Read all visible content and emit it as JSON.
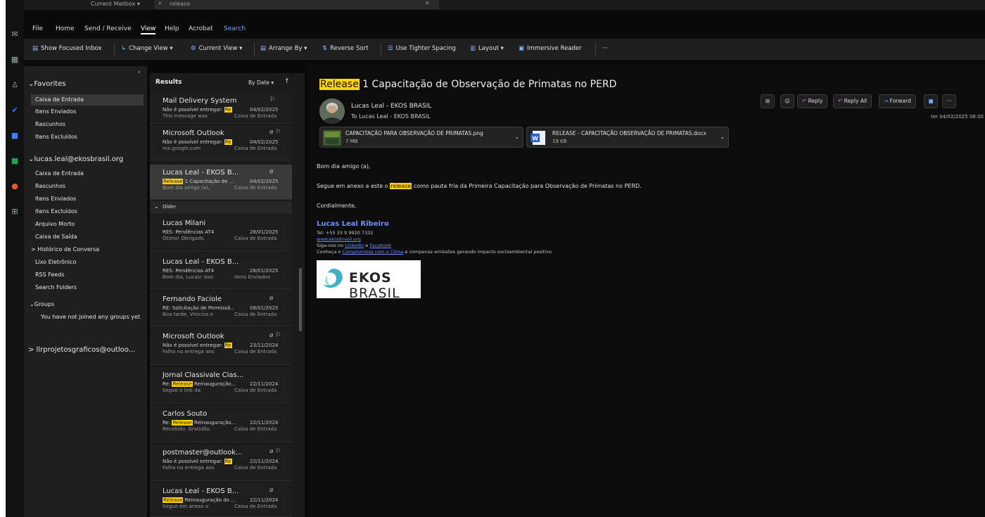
{
  "titlebar": {
    "mailbox_label": "Current Mailbox ▾",
    "search_text": "release"
  },
  "menu": {
    "file": "File",
    "home": "Home",
    "send_receive": "Send / Receive",
    "view": "View",
    "help": "Help",
    "acrobat": "Acrobat",
    "search": "Search"
  },
  "ribbon": {
    "focused_inbox": "Show Focused Inbox",
    "change_view": "Change View ▾",
    "current_view": "Current View ▾",
    "arrange_by": "Arrange By ▾",
    "reverse_sort": "Reverse Sort",
    "tighter_spacing": "Use Tighter Spacing",
    "layout": "Layout ▾",
    "immersive_reader": "Immersive Reader",
    "more": "···"
  },
  "folders": {
    "favorites_label": "Favorites",
    "favorites": [
      "Caixa de Entrada",
      "Itens Enviados",
      "Rascunhos",
      "Itens Excluídos"
    ],
    "account_label": "lucas.leal@ekosbrasil.org",
    "account_items": [
      "Caixa de Entrada",
      "Rascunhos",
      "Itens Enviados",
      "Itens Excluídos",
      "Arquivo Morto",
      "Caixa de Saída",
      "> Histórico de Conversa",
      "Lixo Eletrônico",
      "RSS Feeds",
      "Search Folders"
    ],
    "groups_label": "Groups",
    "groups_text": "You have not joined any groups yet",
    "other_account": "> llrprojetosgraficos@outloo..."
  },
  "list": {
    "title": "Results",
    "sort": "By Date ▾",
    "older_label": "Older",
    "items": [
      {
        "sender": "Mail Delivery System",
        "subject_pre": "Não é possível entregar: ",
        "subject_hl": "Re",
        "subject_post": "",
        "date": "04/02/2025",
        "preview": "This message was",
        "folder": "Caixa de Entrada",
        "icons": "⚐"
      },
      {
        "sender": "Microsoft Outlook",
        "subject_pre": "Não é possível entregar: ",
        "subject_hl": "Re",
        "subject_post": "",
        "date": "04/02/2025",
        "preview": "mx.google.com",
        "folder": "Caixa de Entrada",
        "icons": "⌀ ⚐"
      },
      {
        "sender": "Lucas Leal - EKOS B...",
        "subject_pre": "",
        "subject_hl": "Release",
        "subject_post": " 1 Capacitação de ...",
        "date": "04/02/2025",
        "preview": "Bom dia amigo (a),",
        "folder": "Caixa de Entrada",
        "icons": "⌀"
      },
      {
        "sender": "Lucas Milani",
        "subject_pre": "RES: Pendências AT4",
        "subject_hl": "",
        "subject_post": "",
        "date": "28/01/2025",
        "preview": "Ótimo! Obrigado,",
        "folder": "Caixa de Entrada",
        "icons": ""
      },
      {
        "sender": "Lucas Leal - EKOS B...",
        "subject_pre": "RES: Pendências AT4",
        "subject_hl": "",
        "subject_post": "",
        "date": "28/01/2025",
        "preview": "Bom dia, Lucas! Isso",
        "folder": "Itens Enviados",
        "icons": ""
      },
      {
        "sender": "Fernando Faciole",
        "subject_pre": "RE: Solicitação de Permissã...",
        "subject_hl": "",
        "subject_post": "",
        "date": "08/01/2025",
        "preview": "Boa tarde, Vinicius e",
        "folder": "Caixa de Entrada",
        "icons": "⌀"
      },
      {
        "sender": "Microsoft Outlook",
        "subject_pre": "Não é possível entregar: ",
        "subject_hl": "Re",
        "subject_post": "",
        "date": "23/11/2024",
        "preview": "Falha na entrega aos",
        "folder": "Caixa de Entrada",
        "icons": "⌀ ⚐"
      },
      {
        "sender": "Jornal Classivale Clas...",
        "subject_pre": "Re: ",
        "subject_hl": "Release",
        "subject_post": " Reinauguração...",
        "date": "22/11/2024",
        "preview": "Segue o link da",
        "folder": "Caixa de Entrada",
        "icons": ""
      },
      {
        "sender": "Carlos Souto",
        "subject_pre": "Re: ",
        "subject_hl": "Release",
        "subject_post": " Reinauguração...",
        "date": "22/11/2024",
        "preview": "Recebido. Gratidão.",
        "folder": "Caixa de Entrada",
        "icons": ""
      },
      {
        "sender": "postmaster@outlook...",
        "subject_pre": "Não é possível entregar: ",
        "subject_hl": "Re",
        "subject_post": "",
        "date": "22/11/2024",
        "preview": "Falha na entrega aos",
        "folder": "Caixa de Entrada",
        "icons": "⌀ ⚐"
      },
      {
        "sender": "Lucas Leal - EKOS B...",
        "subject_pre": "",
        "subject_hl": "Release",
        "subject_post": " Reinauguração do ...",
        "date": "22/11/2024",
        "preview": "Segue em anexo o",
        "folder": "Caixa de Entrada",
        "icons": "⌀"
      }
    ]
  },
  "reading": {
    "subject_hl": "Release",
    "subject_rest": " 1 Capacitação de Observação de Primatas no PERD",
    "from": "Lucas Leal - EKOS BRASIL",
    "to": "To  Lucas Leal - EKOS BRASIL",
    "timestamp": "ter 04/02/2025 08:00",
    "buttons": {
      "reply": "Reply",
      "reply_all": "Reply All",
      "forward": "Forward",
      "more": "···"
    },
    "attachments": [
      {
        "name": "CAPACITAÇÃO PARA OBSERVAÇÃO DE PRIMATAS.png",
        "size": "7 MB"
      },
      {
        "name": "RELEASE - CAPACITAÇÃO OBSERVAÇÃO DE PRIMATAS.docx",
        "size": "19 KB"
      }
    ],
    "greeting": "Bom dia amigo (a),",
    "body_pre": "Segue em anexo a este o ",
    "body_hl": "release",
    "body_post": " como pauta fria da Primeira Capacitação para Observação de Primatas no PERD.",
    "closing": "Cordialmente,",
    "signature": {
      "name": "Lucas Leal Ribeiro",
      "phone": "Tel: +55 33 9 9920 7332",
      "website": "www.ekosbrasil.org",
      "follow_pre": "Siga-nos no ",
      "linkedin": "LinkedIn",
      "follow_mid": " e ",
      "facebook": "Facebook",
      "climate_pre": "Conheça o ",
      "climate_link": "Compromisso com o Clima",
      "climate_post": " e compense emissões gerando impacto socioambiental positivo.",
      "logo_text_bold": "EKOS",
      "logo_text_light": " BRASIL"
    }
  }
}
